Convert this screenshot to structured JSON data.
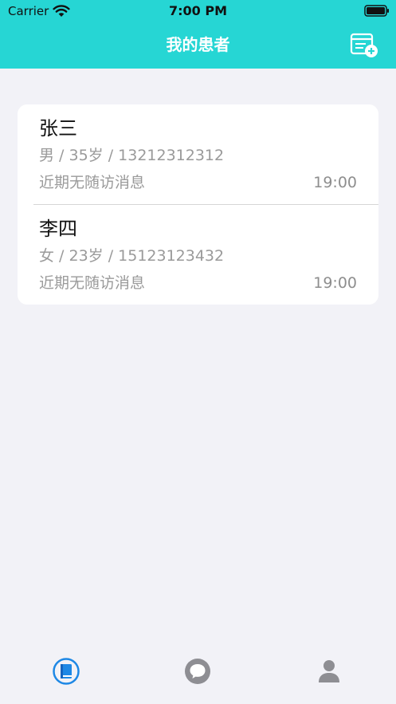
{
  "status_bar": {
    "carrier": "Carrier",
    "time": "7:00 PM"
  },
  "nav": {
    "title": "我的患者",
    "add_icon": "add-patient-icon"
  },
  "patients": [
    {
      "name": "张三",
      "info": "男 / 35岁 / 13212312312",
      "message": "近期无随访消息",
      "time": "19:00"
    },
    {
      "name": "李四",
      "info": "女 / 23岁 / 15123123432",
      "message": "近期无随访消息",
      "time": "19:00"
    }
  ],
  "tabs": [
    {
      "icon": "book-icon",
      "active": true
    },
    {
      "icon": "chat-bubble-icon",
      "active": false
    },
    {
      "icon": "person-icon",
      "active": false
    }
  ],
  "colors": {
    "header": "#26d6d4",
    "background": "#f2f2f7",
    "tab_active": "#1e88e5",
    "tab_inactive": "#8e8e93",
    "secondary_text": "#9a9a9a"
  }
}
